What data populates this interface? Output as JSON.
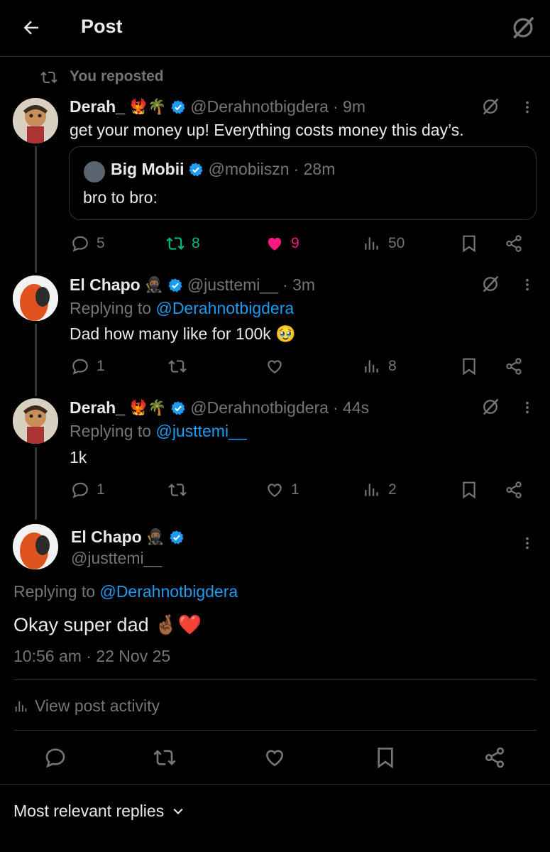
{
  "header": {
    "title": "Post"
  },
  "repost_banner": {
    "text": "You reposted"
  },
  "main_post": {
    "name": "Derah_",
    "name_emojis": "🐦‍🔥🌴",
    "handle": "@Derahnotbigdera",
    "time": "· 9m",
    "text": "get your money up! Everything costs money this day’s.",
    "quote": {
      "name": "Big Mobii",
      "handle": "@mobiiszn",
      "time": "· 28m",
      "text": "bro to bro:"
    },
    "replies": "5",
    "reposts": "8",
    "likes": "9",
    "views": "50"
  },
  "reply1": {
    "name": "El Chapo",
    "handle": "@justtemi__",
    "time": "· 3m",
    "replying_prefix": "Replying to",
    "replying_handle": "@Derahnotbigdera",
    "text": "Dad how many like for 100k 🥹",
    "replies": "1",
    "views": "8"
  },
  "reply2": {
    "name": "Derah_",
    "name_emojis": "🐦‍🔥🌴",
    "handle": "@Derahnotbigdera",
    "time": "· 44s",
    "replying_prefix": "Replying to",
    "replying_handle": "@justtemi__",
    "text": "1k",
    "replies": "1",
    "likes": "1",
    "views": "2"
  },
  "focused": {
    "name": "El Chapo",
    "handle": "@justtemi__",
    "replying_prefix": "Replying to",
    "replying_handle": "@Derahnotbigdera",
    "text": "Okay super dad 🤞🏾❤️",
    "timestamp": "10:56 am · 22 Nov 25",
    "view_activity": "View post activity"
  },
  "sort": {
    "label": "Most relevant replies"
  },
  "colors": {
    "bg": "#000000",
    "text": "#e7e9ea",
    "muted": "#71767b",
    "blue": "#1d9bf0",
    "green": "#00ba7c",
    "pink": "#f91880"
  }
}
